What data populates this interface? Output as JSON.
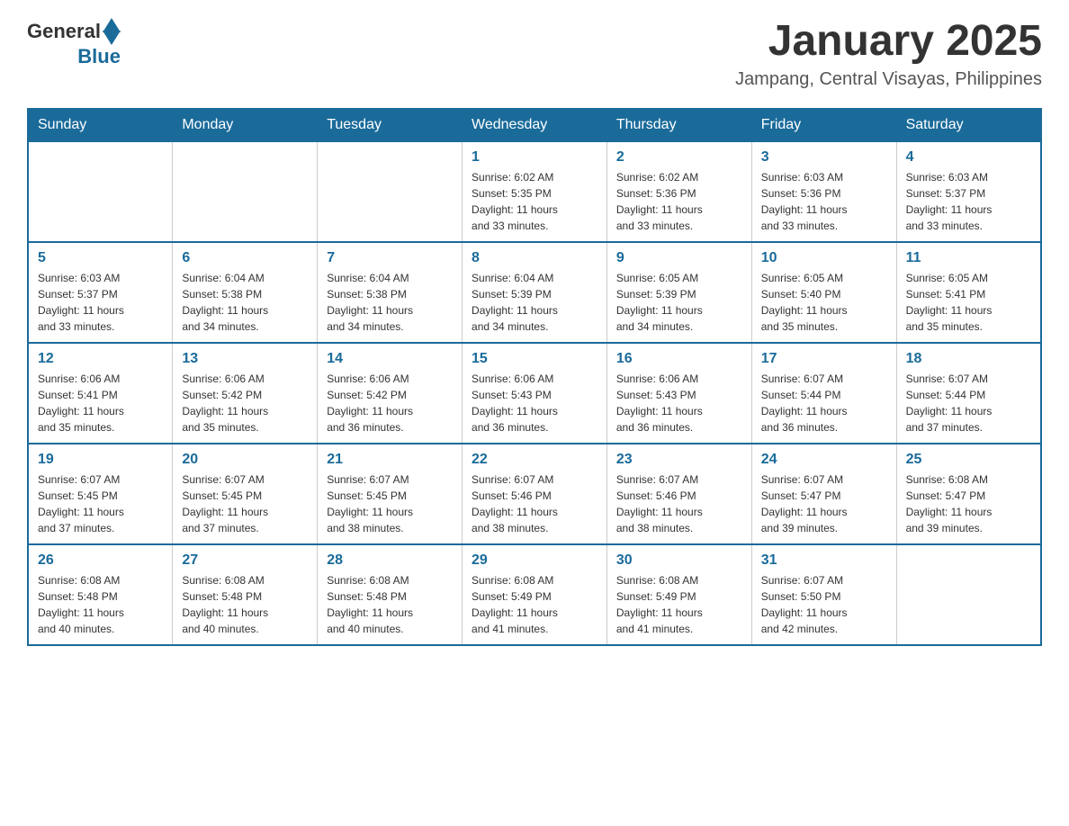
{
  "header": {
    "logo": {
      "general": "General",
      "blue": "Blue"
    },
    "title": "January 2025",
    "subtitle": "Jampang, Central Visayas, Philippines"
  },
  "days_of_week": [
    "Sunday",
    "Monday",
    "Tuesday",
    "Wednesday",
    "Thursday",
    "Friday",
    "Saturday"
  ],
  "weeks": [
    {
      "cells": [
        {
          "day": "",
          "details": ""
        },
        {
          "day": "",
          "details": ""
        },
        {
          "day": "",
          "details": ""
        },
        {
          "day": "1",
          "details": "Sunrise: 6:02 AM\nSunset: 5:35 PM\nDaylight: 11 hours\nand 33 minutes."
        },
        {
          "day": "2",
          "details": "Sunrise: 6:02 AM\nSunset: 5:36 PM\nDaylight: 11 hours\nand 33 minutes."
        },
        {
          "day": "3",
          "details": "Sunrise: 6:03 AM\nSunset: 5:36 PM\nDaylight: 11 hours\nand 33 minutes."
        },
        {
          "day": "4",
          "details": "Sunrise: 6:03 AM\nSunset: 5:37 PM\nDaylight: 11 hours\nand 33 minutes."
        }
      ]
    },
    {
      "cells": [
        {
          "day": "5",
          "details": "Sunrise: 6:03 AM\nSunset: 5:37 PM\nDaylight: 11 hours\nand 33 minutes."
        },
        {
          "day": "6",
          "details": "Sunrise: 6:04 AM\nSunset: 5:38 PM\nDaylight: 11 hours\nand 34 minutes."
        },
        {
          "day": "7",
          "details": "Sunrise: 6:04 AM\nSunset: 5:38 PM\nDaylight: 11 hours\nand 34 minutes."
        },
        {
          "day": "8",
          "details": "Sunrise: 6:04 AM\nSunset: 5:39 PM\nDaylight: 11 hours\nand 34 minutes."
        },
        {
          "day": "9",
          "details": "Sunrise: 6:05 AM\nSunset: 5:39 PM\nDaylight: 11 hours\nand 34 minutes."
        },
        {
          "day": "10",
          "details": "Sunrise: 6:05 AM\nSunset: 5:40 PM\nDaylight: 11 hours\nand 35 minutes."
        },
        {
          "day": "11",
          "details": "Sunrise: 6:05 AM\nSunset: 5:41 PM\nDaylight: 11 hours\nand 35 minutes."
        }
      ]
    },
    {
      "cells": [
        {
          "day": "12",
          "details": "Sunrise: 6:06 AM\nSunset: 5:41 PM\nDaylight: 11 hours\nand 35 minutes."
        },
        {
          "day": "13",
          "details": "Sunrise: 6:06 AM\nSunset: 5:42 PM\nDaylight: 11 hours\nand 35 minutes."
        },
        {
          "day": "14",
          "details": "Sunrise: 6:06 AM\nSunset: 5:42 PM\nDaylight: 11 hours\nand 36 minutes."
        },
        {
          "day": "15",
          "details": "Sunrise: 6:06 AM\nSunset: 5:43 PM\nDaylight: 11 hours\nand 36 minutes."
        },
        {
          "day": "16",
          "details": "Sunrise: 6:06 AM\nSunset: 5:43 PM\nDaylight: 11 hours\nand 36 minutes."
        },
        {
          "day": "17",
          "details": "Sunrise: 6:07 AM\nSunset: 5:44 PM\nDaylight: 11 hours\nand 36 minutes."
        },
        {
          "day": "18",
          "details": "Sunrise: 6:07 AM\nSunset: 5:44 PM\nDaylight: 11 hours\nand 37 minutes."
        }
      ]
    },
    {
      "cells": [
        {
          "day": "19",
          "details": "Sunrise: 6:07 AM\nSunset: 5:45 PM\nDaylight: 11 hours\nand 37 minutes."
        },
        {
          "day": "20",
          "details": "Sunrise: 6:07 AM\nSunset: 5:45 PM\nDaylight: 11 hours\nand 37 minutes."
        },
        {
          "day": "21",
          "details": "Sunrise: 6:07 AM\nSunset: 5:45 PM\nDaylight: 11 hours\nand 38 minutes."
        },
        {
          "day": "22",
          "details": "Sunrise: 6:07 AM\nSunset: 5:46 PM\nDaylight: 11 hours\nand 38 minutes."
        },
        {
          "day": "23",
          "details": "Sunrise: 6:07 AM\nSunset: 5:46 PM\nDaylight: 11 hours\nand 38 minutes."
        },
        {
          "day": "24",
          "details": "Sunrise: 6:07 AM\nSunset: 5:47 PM\nDaylight: 11 hours\nand 39 minutes."
        },
        {
          "day": "25",
          "details": "Sunrise: 6:08 AM\nSunset: 5:47 PM\nDaylight: 11 hours\nand 39 minutes."
        }
      ]
    },
    {
      "cells": [
        {
          "day": "26",
          "details": "Sunrise: 6:08 AM\nSunset: 5:48 PM\nDaylight: 11 hours\nand 40 minutes."
        },
        {
          "day": "27",
          "details": "Sunrise: 6:08 AM\nSunset: 5:48 PM\nDaylight: 11 hours\nand 40 minutes."
        },
        {
          "day": "28",
          "details": "Sunrise: 6:08 AM\nSunset: 5:48 PM\nDaylight: 11 hours\nand 40 minutes."
        },
        {
          "day": "29",
          "details": "Sunrise: 6:08 AM\nSunset: 5:49 PM\nDaylight: 11 hours\nand 41 minutes."
        },
        {
          "day": "30",
          "details": "Sunrise: 6:08 AM\nSunset: 5:49 PM\nDaylight: 11 hours\nand 41 minutes."
        },
        {
          "day": "31",
          "details": "Sunrise: 6:07 AM\nSunset: 5:50 PM\nDaylight: 11 hours\nand 42 minutes."
        },
        {
          "day": "",
          "details": ""
        }
      ]
    }
  ]
}
